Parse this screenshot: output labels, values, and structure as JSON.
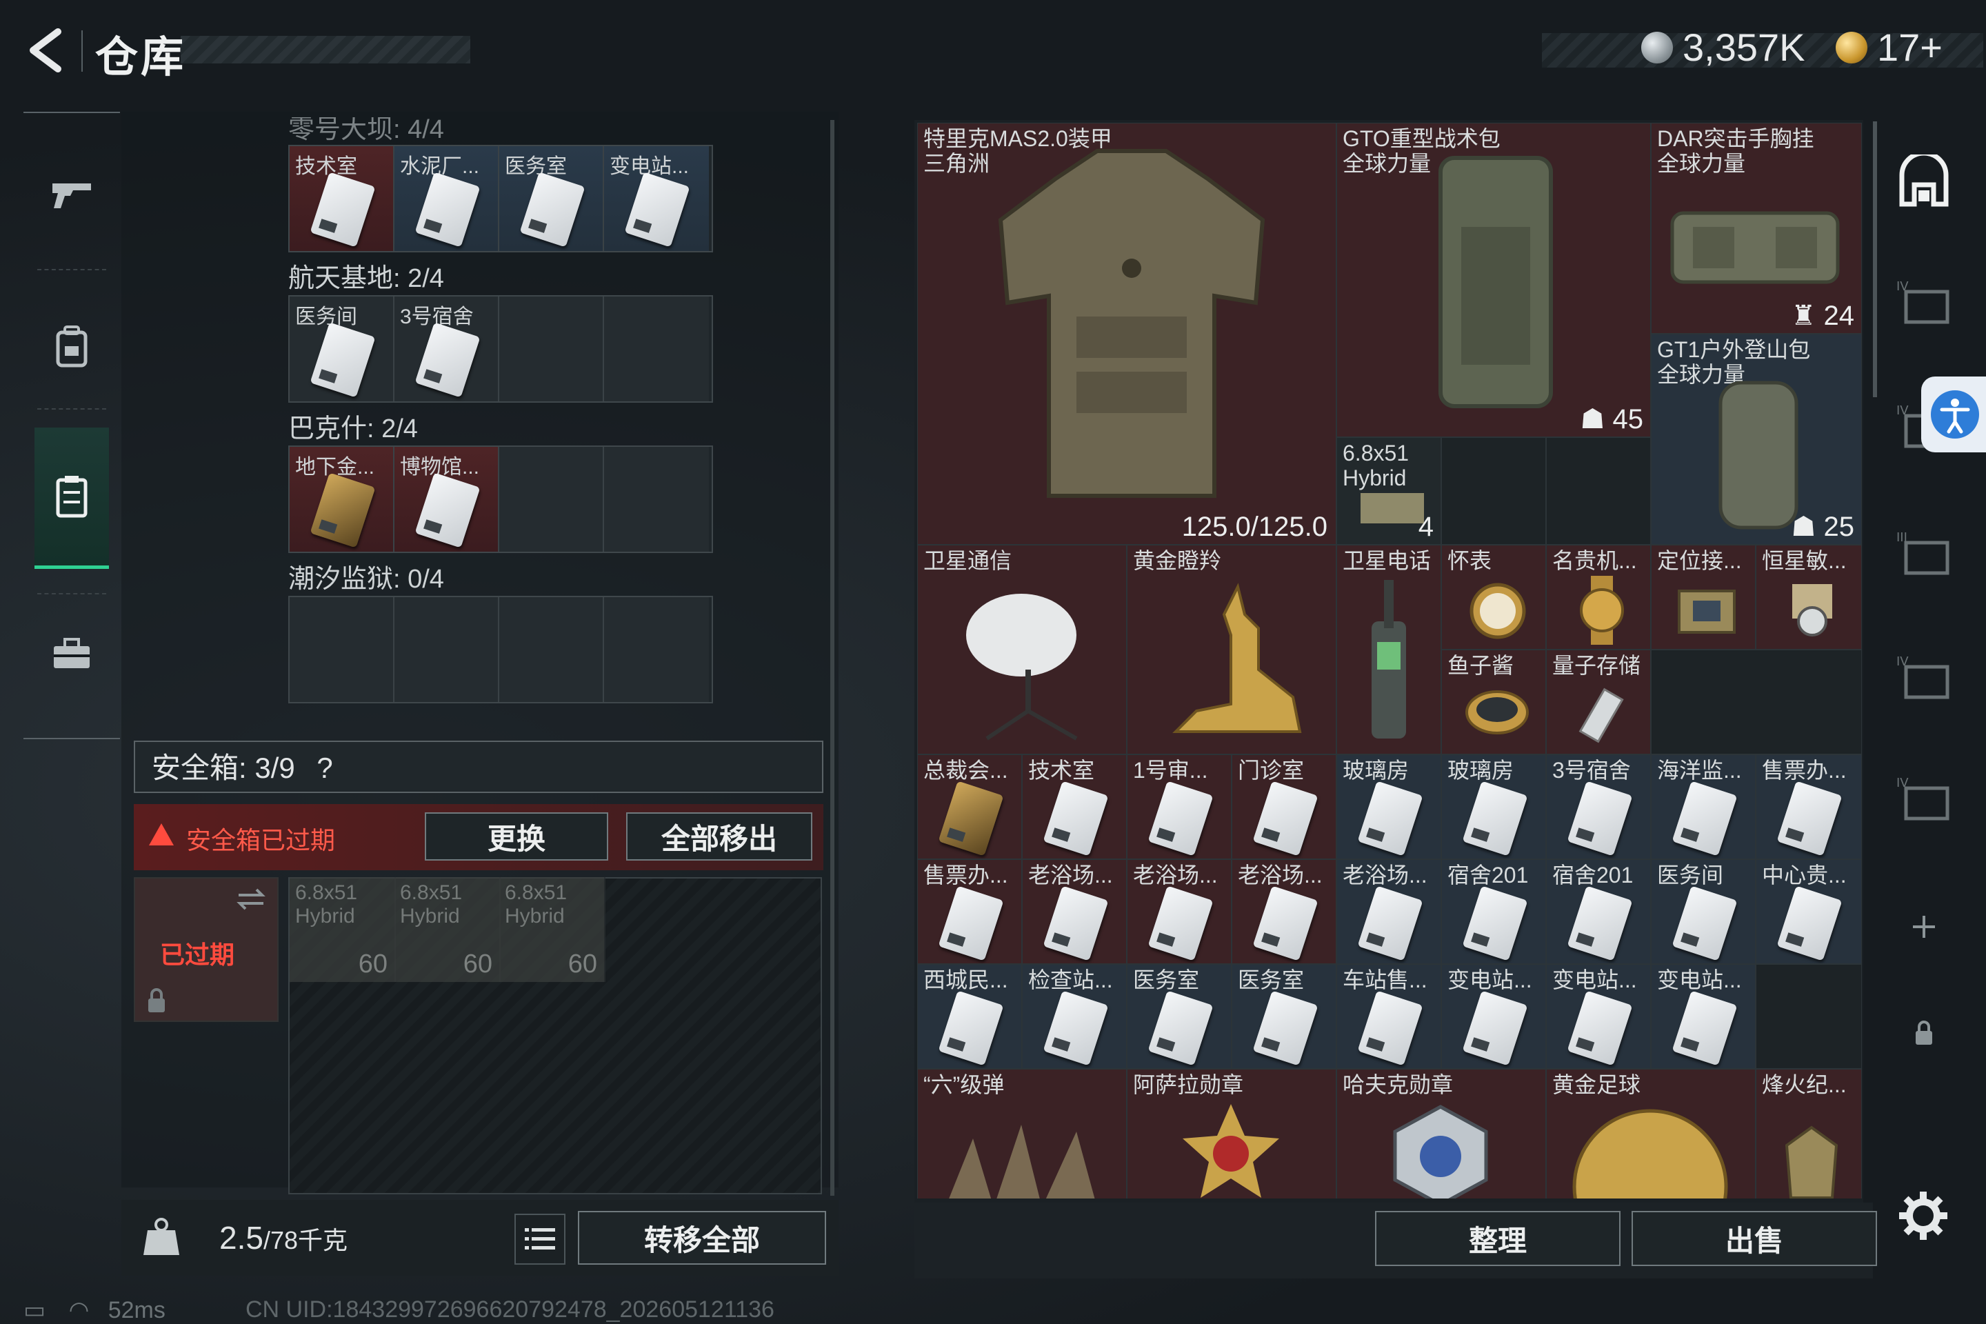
{
  "header": {
    "title": "仓库",
    "currency_silver": "3,357K",
    "currency_gold": "17+"
  },
  "sidebar": {
    "items": [
      "gun-icon",
      "backpack-icon",
      "locker-icon",
      "toolbox-icon"
    ]
  },
  "left": {
    "top_partial_label": "零号大坝: 4/4",
    "row1": [
      "技术室",
      "水泥厂...",
      "医务室",
      "变电站..."
    ],
    "group2_label": "航天基地: 2/4",
    "row2": [
      "医务间",
      "3号宿舍"
    ],
    "group3_label": "巴克什: 2/4",
    "row3": [
      "地下金...",
      "博物馆..."
    ],
    "group4_label": "潮汐监狱: 0/4",
    "safe_title": "安全箱: 3/9",
    "safe_help": "?",
    "safe_warning": "安全箱已过期",
    "replace_button": "更换",
    "remove_all_button": "全部移出",
    "expired_label": "已过期",
    "ammo_label": "6.8x51 Hybrid",
    "ammo_count": "60",
    "weight_value": "2.5",
    "weight_unit": "/78千克",
    "transfer_all_button": "转移全部"
  },
  "right": {
    "armor": {
      "name": "特里克MAS2.0装甲",
      "source": "三角洲",
      "durability": "125.0/125.0"
    },
    "gto_bag": {
      "name": "GTO重型战术包",
      "source": "全球力量",
      "count": "45"
    },
    "dar_rig": {
      "name": "DAR突击手胸挂",
      "source": "全球力量",
      "count": "24"
    },
    "gt1_bag": {
      "name": "GT1户外登山包",
      "source": "全球力量",
      "count": "25"
    },
    "ammo": {
      "name": "6.8x51 Hybrid",
      "count": "4"
    },
    "row_items": [
      "卫星通信",
      "黄金瞪羚",
      "卫星电话",
      "怀表",
      "名贵机...",
      "定位接...",
      "恒星敏...",
      "鱼子酱",
      "量子存储"
    ],
    "key_row1": [
      "总裁会...",
      "技术室",
      "1号审...",
      "门诊室",
      "玻璃房",
      "玻璃房",
      "3号宿舍",
      "海洋监...",
      "售票办..."
    ],
    "key_row2": [
      "售票办...",
      "老浴场...",
      "老浴场...",
      "老浴场...",
      "老浴场...",
      "宿舍201",
      "宿舍201",
      "医务间",
      "中心贵..."
    ],
    "key_row3": [
      "西城民...",
      "检查站...",
      "医务室",
      "医务室",
      "车站售...",
      "变电站...",
      "变电站...",
      "变电站..."
    ],
    "bottom_row": [
      "“六”级弹",
      "阿萨拉勋章",
      "哈夫克勋章",
      "黄金足球",
      "烽火纪..."
    ],
    "organize_button": "整理",
    "sell_button": "出售"
  },
  "status": {
    "ping": "52ms",
    "uid": "CN UID:18432997269662079247​8_202605121136"
  },
  "colors": {
    "accent_green": "#2fd193",
    "warning_red": "#ff4b3e",
    "rare_red_bg": "#3b2225",
    "rare_blue_bg": "#27323d"
  }
}
